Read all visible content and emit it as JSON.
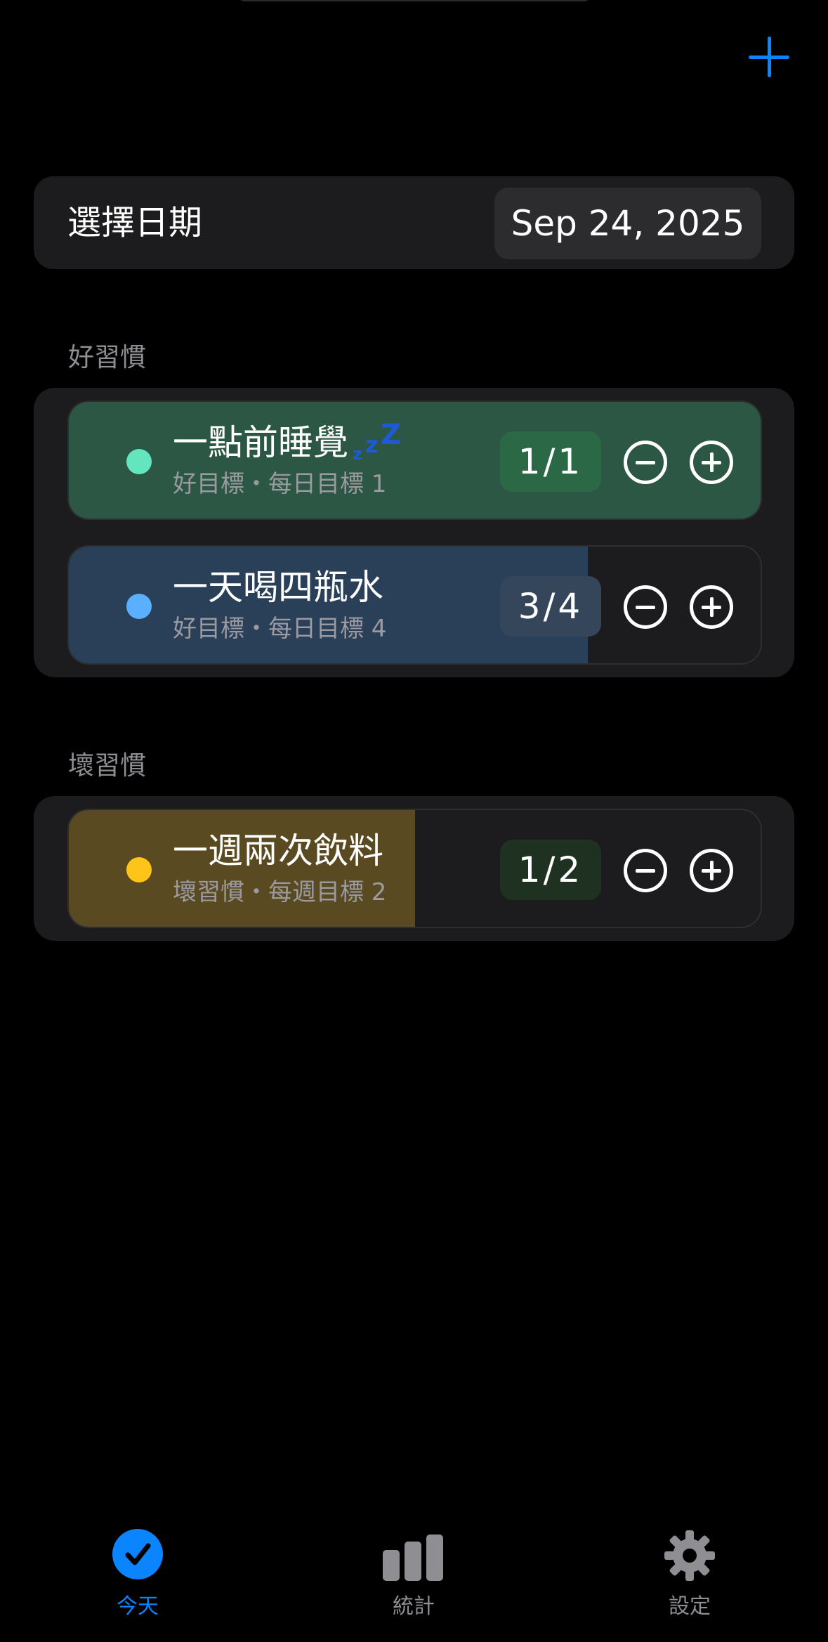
{
  "toolbar": {
    "add_icon": "plus-icon",
    "accent": "#0a84ff"
  },
  "date_picker": {
    "label": "選擇日期",
    "value": "Sep 24, 2025"
  },
  "sections": [
    {
      "title": "好習慣",
      "habits": [
        {
          "name": "一點前睡覺",
          "subtitle": "好目標・每日目標 1",
          "count": "1/1",
          "progress": 1.0,
          "dot_color": "#63e6be",
          "fill_color": "#2c5745",
          "pill_color": "#2a6846",
          "badge_icon": "zzz-icon"
        },
        {
          "name": "一天喝四瓶水",
          "subtitle": "好目標・每日目標 4",
          "count": "3/4",
          "progress": 0.75,
          "dot_color": "#5ab0ff",
          "fill_color": "#2a3f58",
          "pill_color": "#36465a"
        }
      ]
    },
    {
      "title": "壞習慣",
      "habits": [
        {
          "name": "一週兩次飲料",
          "subtitle": "壞習慣・每週目標 2",
          "count": "1/2",
          "progress": 0.5,
          "dot_color": "#ffc419",
          "fill_color": "#5a4a22",
          "pill_color": "#1f3221"
        }
      ]
    }
  ],
  "tabbar": {
    "tabs": [
      {
        "label": "今天",
        "icon": "checkmark-circle-icon",
        "selected": true,
        "color": "#0a84ff"
      },
      {
        "label": "統計",
        "icon": "bar-chart-icon",
        "selected": false,
        "color": "#8e8e93"
      },
      {
        "label": "設定",
        "icon": "gear-icon",
        "selected": false,
        "color": "#8e8e93"
      }
    ]
  }
}
